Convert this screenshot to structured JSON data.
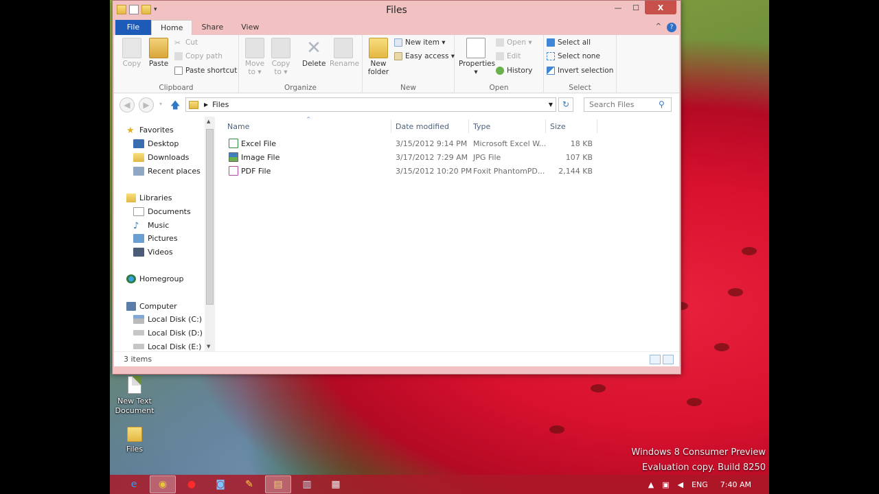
{
  "window": {
    "title": "Files",
    "controls": {
      "minimize": "—",
      "maximize": "☐",
      "close": "X"
    }
  },
  "ribbon_tabs": [
    "File",
    "Home",
    "Share",
    "View"
  ],
  "ribbon": {
    "clipboard": {
      "label": "Clipboard",
      "copy": "Copy",
      "paste": "Paste",
      "cut": "Cut",
      "copy_path": "Copy path",
      "paste_shortcut": "Paste shortcut"
    },
    "organize": {
      "label": "Organize",
      "move_to": [
        "Move",
        "to ▾"
      ],
      "copy_to": [
        "Copy",
        "to ▾"
      ],
      "delete": "Delete",
      "rename": "Rename"
    },
    "new": {
      "label": "New",
      "new_folder": [
        "New",
        "folder"
      ],
      "new_item": "New item ▾",
      "easy_access": "Easy access ▾"
    },
    "open": {
      "label": "Open",
      "properties": [
        "Properties",
        "▾"
      ],
      "open": "Open ▾",
      "edit": "Edit",
      "history": "History"
    },
    "select": {
      "label": "Select",
      "select_all": "Select all",
      "select_none": "Select none",
      "invert_selection": "Invert selection"
    }
  },
  "address": {
    "path": "Files",
    "search_placeholder": "Search Files"
  },
  "nav": {
    "favorites": {
      "label": "Favorites",
      "items": [
        "Desktop",
        "Downloads",
        "Recent places"
      ]
    },
    "libraries": {
      "label": "Libraries",
      "items": [
        "Documents",
        "Music",
        "Pictures",
        "Videos"
      ]
    },
    "homegroup": "Homegroup",
    "computer": {
      "label": "Computer",
      "items": [
        "Local Disk (C:)",
        "Local Disk (D:)",
        "Local Disk (E:)"
      ]
    }
  },
  "columns": [
    "Name",
    "Date modified",
    "Type",
    "Size"
  ],
  "files": [
    {
      "name": "Excel File",
      "date": "3/15/2012 9:14 PM",
      "type": "Microsoft Excel W...",
      "size": "18 KB",
      "color": "#2f8a3d"
    },
    {
      "name": "Image File",
      "date": "3/17/2012 7:29 AM",
      "type": "JPG File",
      "size": "107 KB",
      "color": "#3f7fbf"
    },
    {
      "name": "PDF File",
      "date": "3/15/2012 10:20 PM",
      "type": "Foxit PhantomPD...",
      "size": "2,144 KB",
      "color": "#b04aa6"
    }
  ],
  "status": {
    "items": "3 items"
  },
  "desktop_icons": [
    {
      "label": "New Text Document"
    },
    {
      "label": "Files"
    }
  ],
  "watermark": {
    "line1": "Windows 8 Consumer Preview",
    "line2": "Evaluation copy. Build 8250"
  },
  "tray": {
    "lang": "ENG",
    "time": "7:40 AM"
  },
  "accent_color": "#1d5bb8"
}
